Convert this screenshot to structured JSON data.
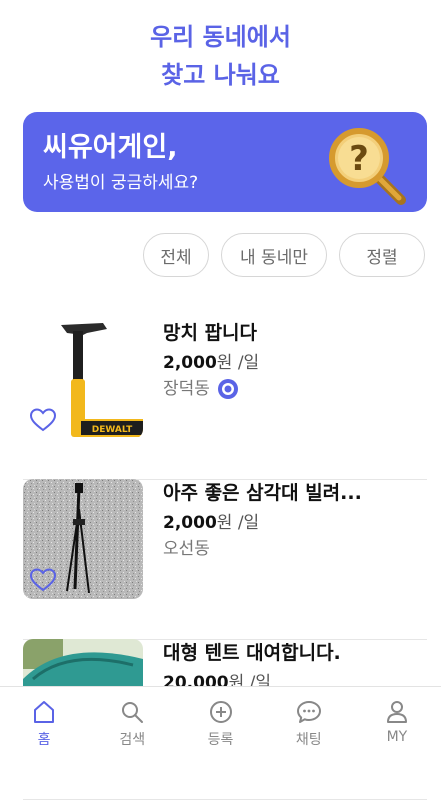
{
  "header": {
    "line1": "우리 동네에서",
    "line2": "찾고 나눠요"
  },
  "banner": {
    "title": "씨유어게인,",
    "subtitle": "사용법이 궁금하세요?",
    "icon": "question-magnifier-icon"
  },
  "filters": [
    "전체",
    "내 동네만",
    "정렬"
  ],
  "items": [
    {
      "title": "망치 팝니다",
      "price": "2,000",
      "unit": "원 /일",
      "location": "장덕동",
      "verified": true
    },
    {
      "title": "아주 좋은 삼각대 빌려...",
      "price": "2,000",
      "unit": "원 /일",
      "location": "오선동",
      "verified": false
    },
    {
      "title": "대형 텐트 대여합니다.",
      "price": "20,000",
      "unit": "원 /일",
      "location": "",
      "verified": false
    }
  ],
  "nav": [
    {
      "label": "홈",
      "icon": "home-icon",
      "active": true
    },
    {
      "label": "검색",
      "icon": "search-icon",
      "active": false
    },
    {
      "label": "등록",
      "icon": "plus-circle-icon",
      "active": false
    },
    {
      "label": "채팅",
      "icon": "chat-icon",
      "active": false
    },
    {
      "label": "MY",
      "icon": "user-icon",
      "active": false
    }
  ],
  "colors": {
    "accent": "#5a63e6",
    "banner": "#5b65ea"
  }
}
